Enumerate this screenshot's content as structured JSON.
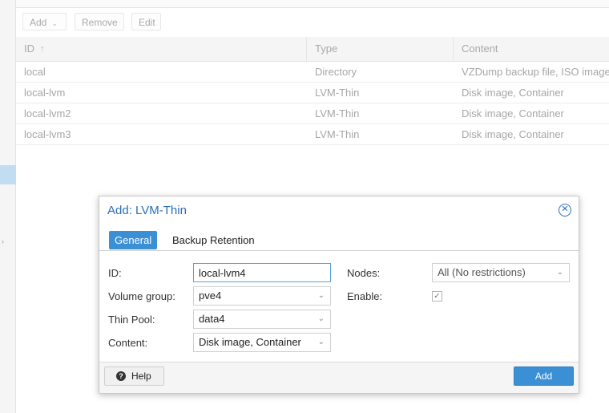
{
  "toolbar": {
    "add_label": "Add",
    "remove_label": "Remove",
    "edit_label": "Edit"
  },
  "grid": {
    "columns": [
      "ID",
      "Type",
      "Content"
    ],
    "sort_indicator": "↑",
    "rows": [
      {
        "id": "local",
        "type": "Directory",
        "content": "VZDump backup file, ISO image"
      },
      {
        "id": "local-lvm",
        "type": "LVM-Thin",
        "content": "Disk image, Container"
      },
      {
        "id": "local-lvm2",
        "type": "LVM-Thin",
        "content": "Disk image, Container"
      },
      {
        "id": "local-lvm3",
        "type": "LVM-Thin",
        "content": "Disk image, Container"
      }
    ]
  },
  "dialog": {
    "title": "Add: LVM-Thin",
    "tabs": [
      "General",
      "Backup Retention"
    ],
    "fields": {
      "id_label": "ID:",
      "id_value": "local-lvm4",
      "volume_group_label": "Volume group:",
      "volume_group_value": "pve4",
      "thin_pool_label": "Thin Pool:",
      "thin_pool_value": "data4",
      "content_label": "Content:",
      "content_value": "Disk image, Container",
      "nodes_label": "Nodes:",
      "nodes_value": "All (No restrictions)",
      "enable_label": "Enable:",
      "enable_checked": true
    },
    "help_label": "Help",
    "add_label": "Add"
  },
  "colors": {
    "accent": "#3b8fd4",
    "title_blue": "#2a6ebb"
  }
}
